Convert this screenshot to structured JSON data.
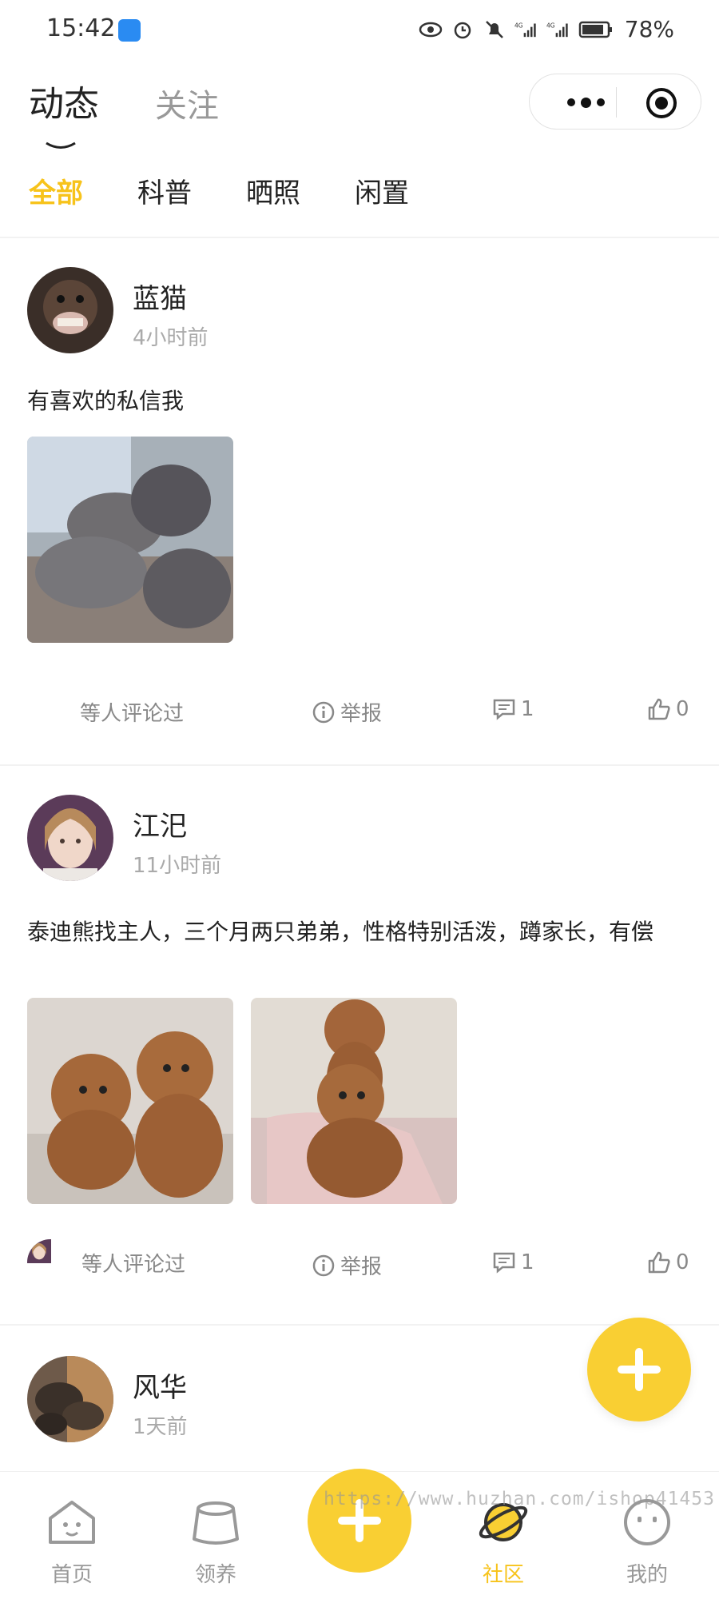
{
  "status": {
    "time": "15:42",
    "battery": "78%",
    "signal_label_1": "4G",
    "signal_label_2": "4G"
  },
  "header": {
    "tabs": [
      {
        "label": "动态",
        "active": true
      },
      {
        "label": "关注",
        "active": false
      }
    ]
  },
  "categories": [
    {
      "label": "全部",
      "active": true
    },
    {
      "label": "科普",
      "active": false
    },
    {
      "label": "晒照",
      "active": false
    },
    {
      "label": "闲置",
      "active": false
    }
  ],
  "posts": [
    {
      "user": "蓝猫",
      "time": "4小时前",
      "text": "有喜欢的私信我",
      "comment_note": "等人评论过",
      "report_label": "举报",
      "comments": "1",
      "likes": "0"
    },
    {
      "user": "江汜",
      "time": "11小时前",
      "text": "泰迪熊找主人，三个月两只弟弟，性格特别活泼，蹲家长，有偿",
      "comment_note": "等人评论过",
      "report_label": "举报",
      "comments": "1",
      "likes": "0"
    },
    {
      "user": "风华",
      "time": "1天前"
    }
  ],
  "bottom_nav": [
    {
      "label": "首页",
      "icon": "home-icon"
    },
    {
      "label": "领养",
      "icon": "bowl-icon"
    },
    {
      "label": "社区",
      "icon": "planet-icon",
      "active": true
    },
    {
      "label": "我的",
      "icon": "face-icon"
    }
  ],
  "watermark": "https://www.huzhan.com/ishop41453",
  "colors": {
    "accent": "#f9cf33",
    "accent_text": "#f7c31b"
  }
}
